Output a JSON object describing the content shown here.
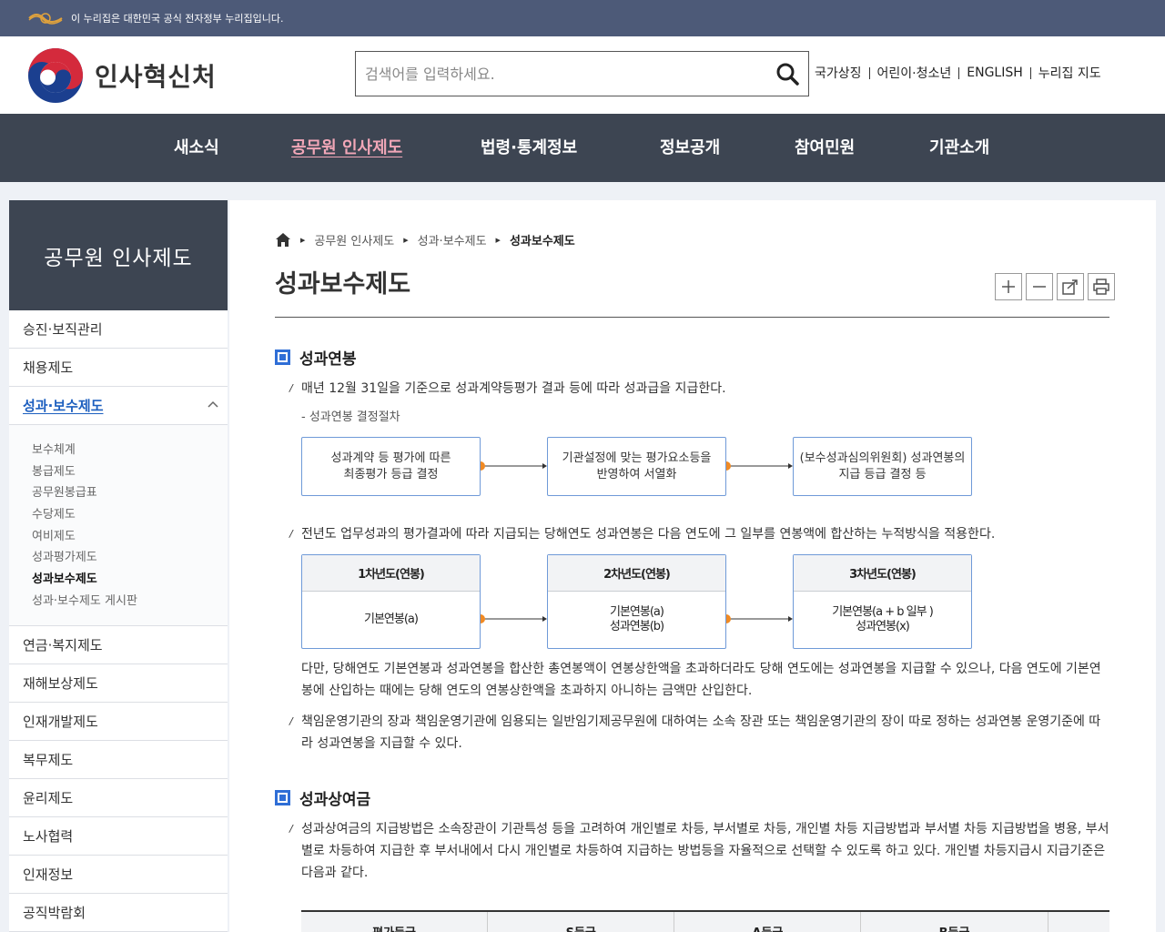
{
  "gov_banner": {
    "text": "이 누리집은 대한민국 공식 전자정부 누리집입니다."
  },
  "header": {
    "logo_text": "인사혁신처",
    "search_placeholder": "검색어를 입력하세요.",
    "util_links": [
      "국가상징",
      "어린이·청소년",
      "ENGLISH",
      "누리집 지도"
    ]
  },
  "gnb": {
    "items": [
      "새소식",
      "공무원 인사제도",
      "법령·통계정보",
      "정보공개",
      "참여민원",
      "기관소개"
    ],
    "active_index": 1
  },
  "lnb": {
    "title": "공무원 인사제도",
    "items_top": [
      "승진·보직관리",
      "채용제도"
    ],
    "active_item": "성과·보수제도",
    "sub_items": [
      "보수체계",
      "봉급제도",
      "공무원봉급표",
      "수당제도",
      "여비제도",
      "성과평가제도",
      "성과보수제도",
      "성과·보수제도 게시판"
    ],
    "current_sub": "성과보수제도",
    "items_bottom": [
      "연금·복지제도",
      "재해보상제도",
      "인재개발제도",
      "복무제도",
      "윤리제도",
      "노사협력",
      "인재정보",
      "공직박람회"
    ]
  },
  "content": {
    "breadcrumb": [
      "공무원 인사제도",
      "성과·보수제도",
      "성과보수제도"
    ],
    "title": "성과보수제도",
    "section1": {
      "heading": "성과연봉",
      "bullet1": "매년 12월 31일을 기준으로 성과계약등평가 결과 등에 따라 성과급을 지급한다.",
      "sub1": "- 성과연봉 결정절차",
      "flow": [
        {
          "line1": "성과계약 등 평가에 따른",
          "line2": "최종평가 등급 결정"
        },
        {
          "line1": "기관설정에 맞는 평가요소등을",
          "line2": "반영하여 서열화"
        },
        {
          "line1": "(보수성과심의위원회) 성과연봉의",
          "line2": "지급 등급 결정 등"
        }
      ],
      "bullet2": "전년도 업무성과의 평가결과에 따라 지급되는 당해연도 성과연봉은 다음 연도에 그 일부를 연봉액에 합산하는 누적방식을 적용한다.",
      "years": [
        {
          "head": "1차년도(연봉)",
          "l1": "기본연봉(a)",
          "l2": ""
        },
        {
          "head": "2차년도(연봉)",
          "l1": "기본연봉(a)",
          "l2": "성과연봉(b)"
        },
        {
          "head": "3차년도(연봉)",
          "l1": "기본연봉(a + b 일부 )",
          "l2": "성과연봉(x)"
        }
      ],
      "para1": "다만, 당해연도 기본연봉과 성과연봉을 합산한 총연봉액이 연봉상한액을 초과하더라도 당해 연도에는 성과연봉을 지급할 수 있으나, 다음 연도에 기본연봉에 산입하는 때에는 당해 연도의 연봉상한액을 초과하지 아니하는 금액만 산입한다.",
      "bullet3": "책임운영기관의 장과 책임운영기관에 임용되는 일반임기제공무원에 대하여는 소속 장관 또는 책임운영기관의 장이 따로 정하는 성과연봉 운영기준에 따라 성과연봉을 지급할 수 있다."
    },
    "section2": {
      "heading": "성과상여금",
      "bullet1": "성과상여금의 지급방법은 소속장관이 기관특성 등을 고려하여 개인별로 차등, 부서별로 차등, 개인별 차등 지급방법과 부서별 차등 지급방법을 병용, 부서별로 차등하여 지급한 후 부서내에서 다시 개인별로 차등하여 지급하는 방법등을 자율적으로 선택할 수 있도록 하고 있다. 개인별 차등지급시 지급기준은 다음과 같다.",
      "table_headers": [
        "평가등급",
        "S등급",
        "A등급",
        "B등급",
        ""
      ]
    }
  },
  "colors": {
    "gov_banner": "#4d5a78",
    "gnb": "#3d4552",
    "accent_blue": "#2f6ed6",
    "flow_dot": "#f08a24",
    "gnb_active": "#f2a7b8"
  }
}
